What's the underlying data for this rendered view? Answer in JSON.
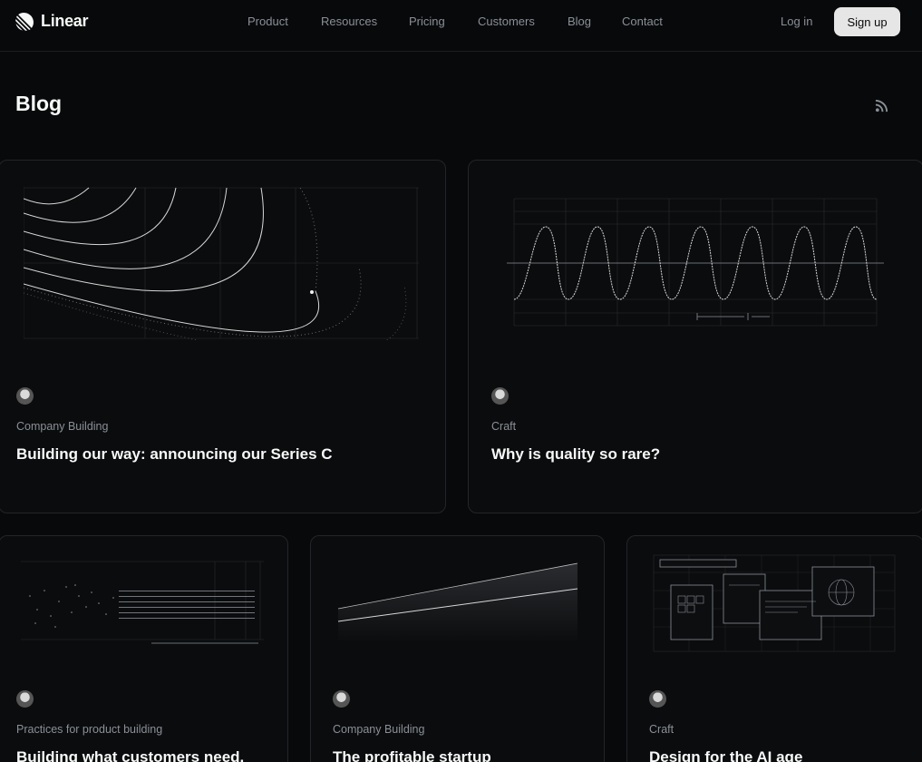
{
  "brand": {
    "name": "Linear"
  },
  "nav": {
    "links": [
      "Product",
      "Resources",
      "Pricing",
      "Customers",
      "Blog",
      "Contact"
    ],
    "login_label": "Log in",
    "signup_label": "Sign up"
  },
  "page": {
    "title": "Blog",
    "rss_icon": "rss-icon"
  },
  "posts": [
    {
      "category": "Company Building",
      "title": "Building our way: announcing our Series C"
    },
    {
      "category": "Craft",
      "title": "Why is quality so rare?"
    },
    {
      "category": "Practices for product building",
      "title": "Building what customers need."
    },
    {
      "category": "Company Building",
      "title": "The profitable startup"
    },
    {
      "category": "Craft",
      "title": "Design for the AI age"
    }
  ]
}
